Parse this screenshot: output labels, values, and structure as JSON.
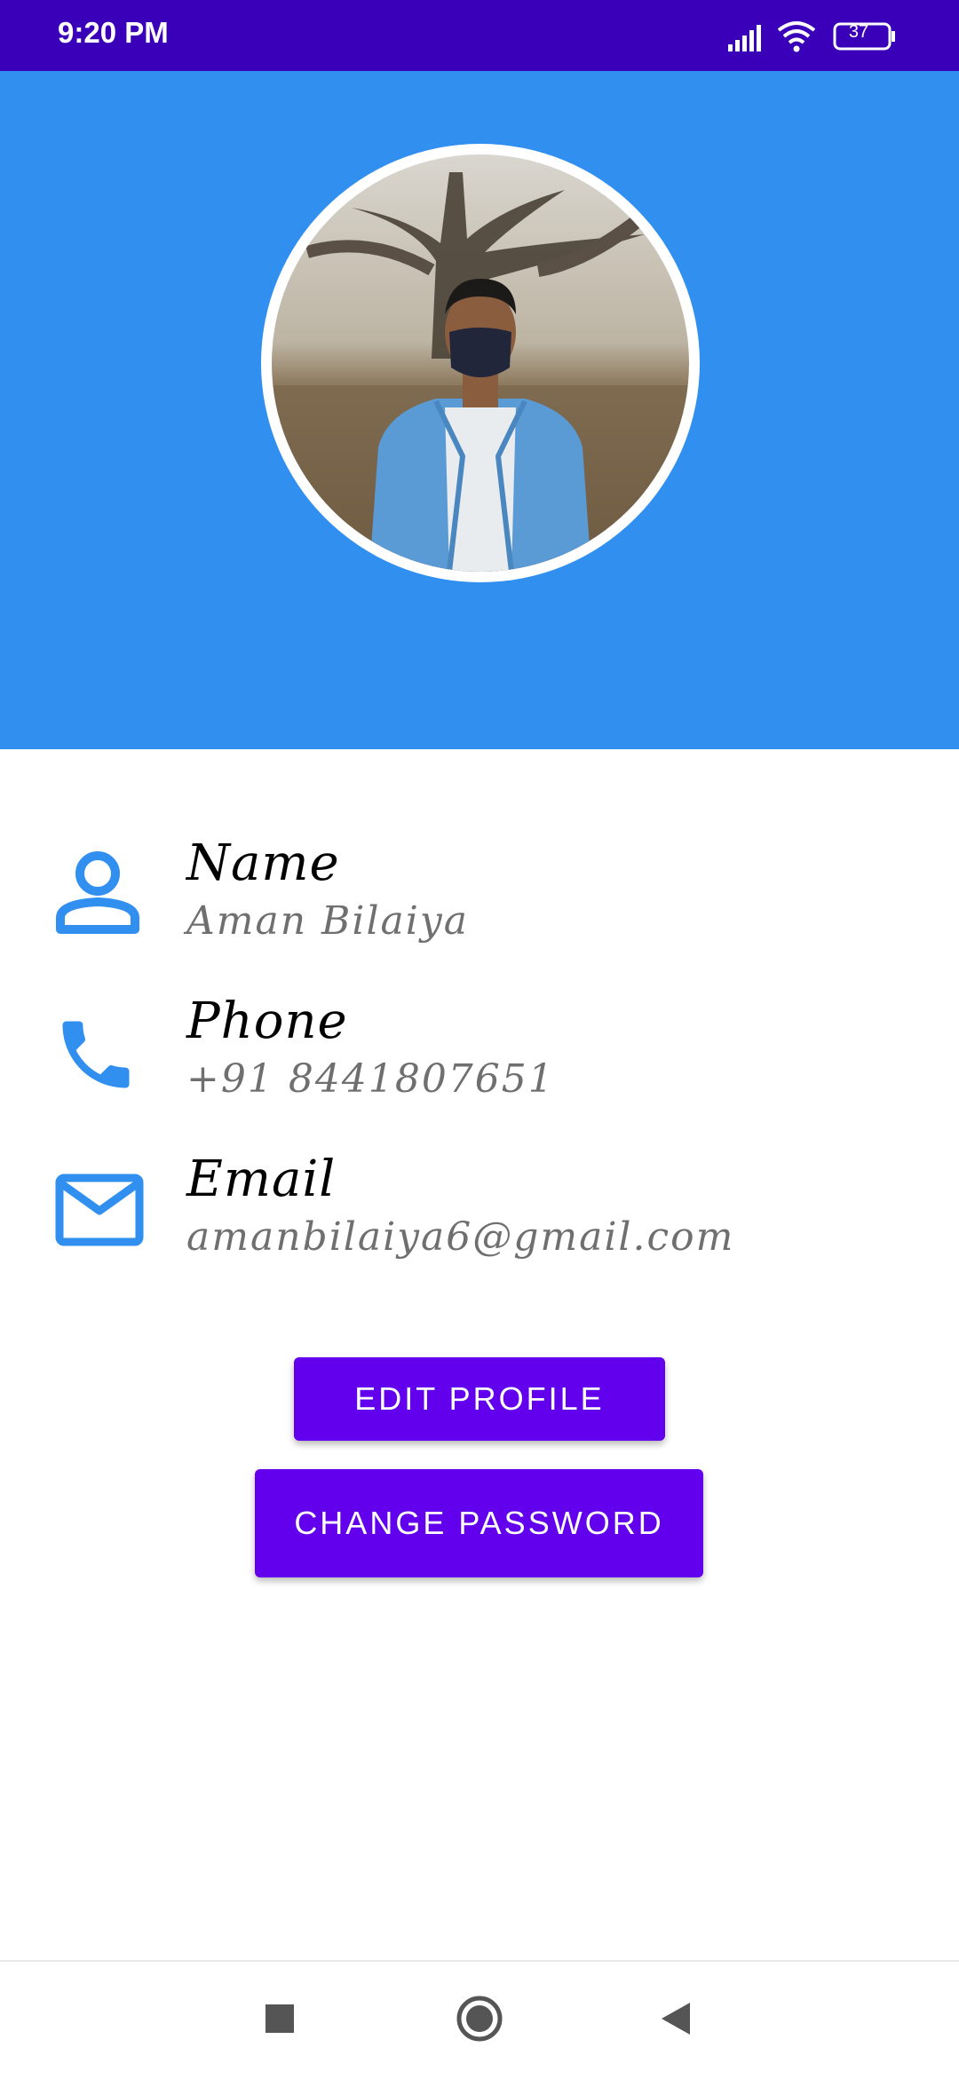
{
  "status_bar": {
    "time": "9:20 PM",
    "battery": "37"
  },
  "profile": {
    "name_label": "Name",
    "name_value": "Aman Bilaiya",
    "phone_label": "Phone",
    "phone_value": "+91 8441807651",
    "email_label": "Email",
    "email_value": "amanbilaiya6@gmail.com"
  },
  "actions": {
    "edit_profile": "EDIT PROFILE",
    "change_password": "CHANGE PASSWORD"
  },
  "colors": {
    "status_bar": "#3a00b9",
    "header": "#3190ef",
    "button": "#6200ee",
    "icon": "#3190ef"
  },
  "icons": {
    "name": "person-icon",
    "phone": "phone-icon",
    "email": "mail-icon",
    "nav_recents": "square-icon",
    "nav_home": "circle-icon",
    "nav_back": "triangle-back-icon"
  }
}
